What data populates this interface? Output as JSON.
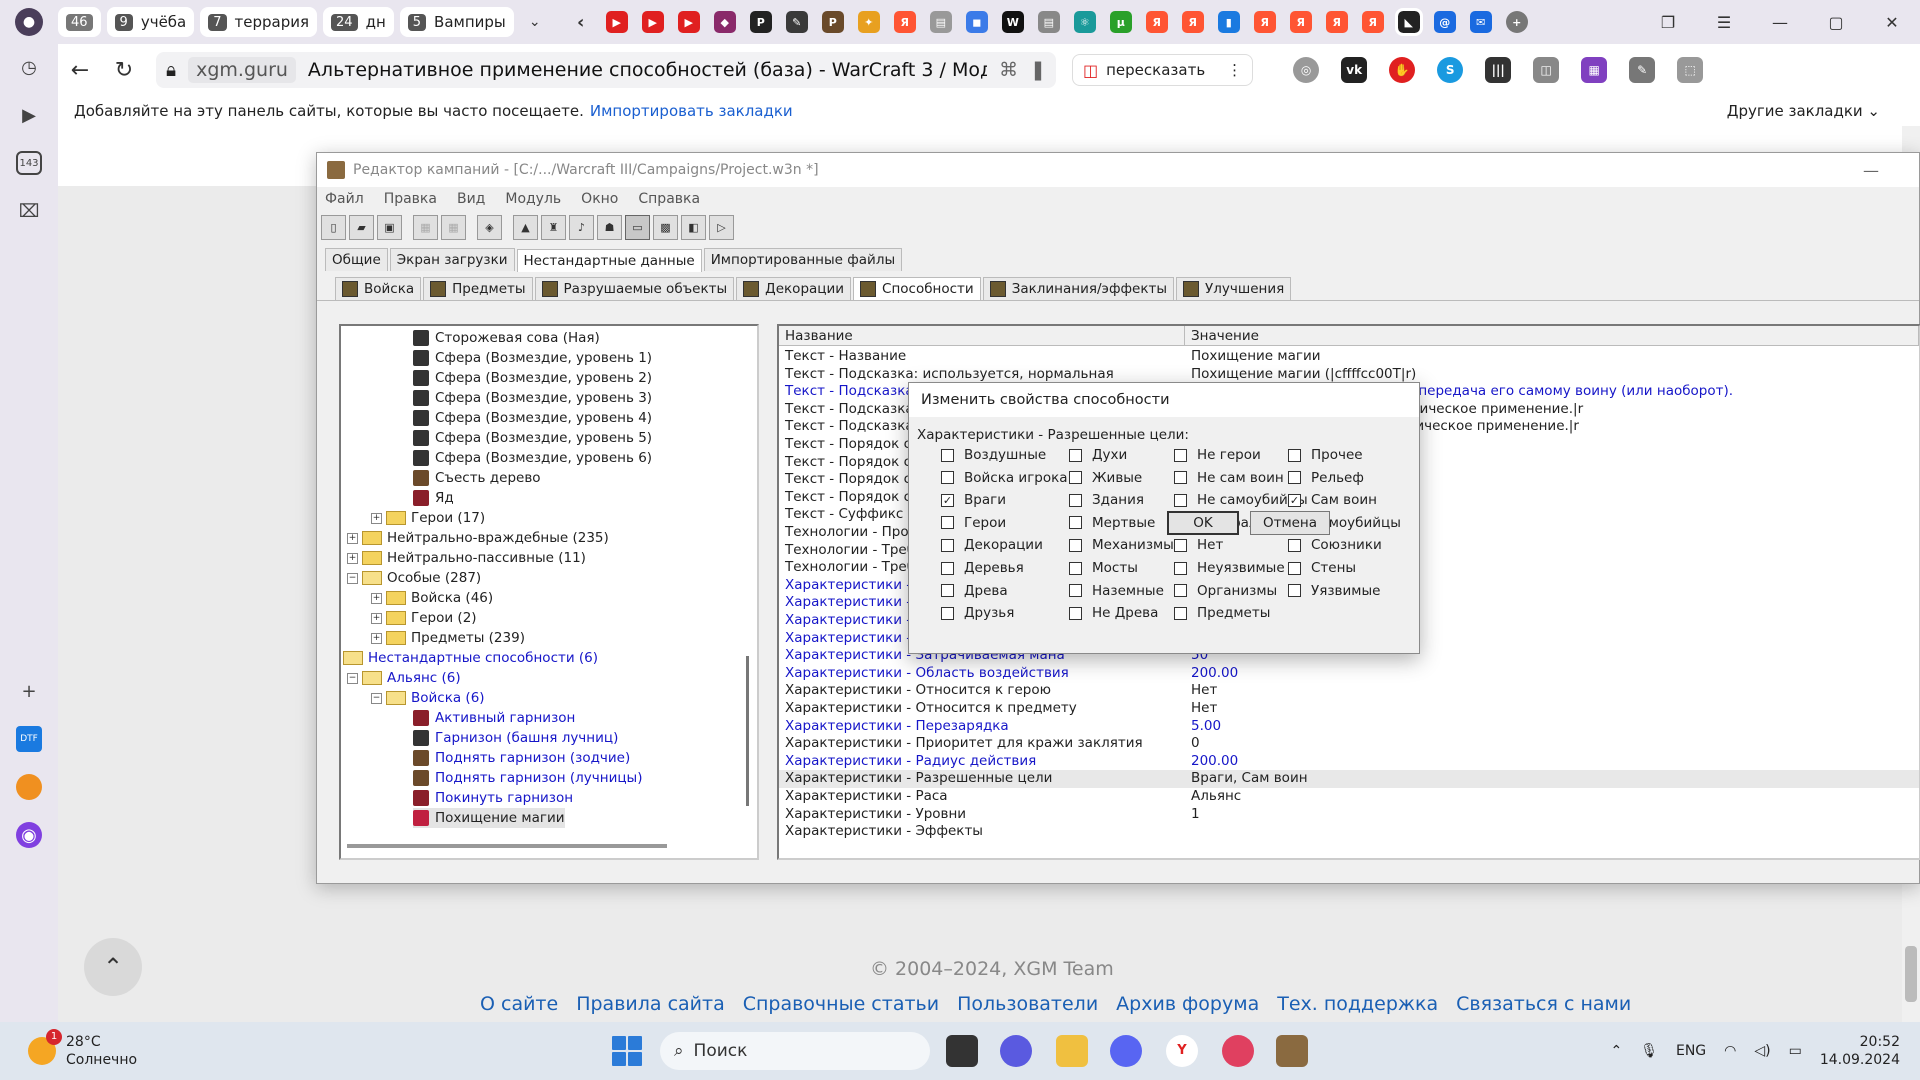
{
  "browser": {
    "tab_groups": [
      {
        "num": "46",
        "label": ""
      },
      {
        "num": "9",
        "label": "учёба"
      },
      {
        "num": "7",
        "label": "террария"
      },
      {
        "num": "24",
        "label": "дн"
      },
      {
        "num": "5",
        "label": "Вампиры"
      }
    ],
    "url_host": "xgm.guru",
    "page_title": "Альтернативное применение способностей (база) - WarCraft 3 / Моддинг - XG...",
    "retell_label": "пересказать",
    "bookmarks_hint": "Добавляйте на эту панель сайты, которые вы часто посещаете.",
    "bookmarks_import": "Импортировать закладки",
    "bookmarks_other": "Другие закладки",
    "sidebar_badge": "143"
  },
  "page": {
    "copyright": "© 2004–2024, XGM Team",
    "footer_links": [
      "О сайте",
      "Правила сайта",
      "Справочные статьи",
      "Пользователи",
      "Архив форума",
      "Тех. поддержка",
      "Связаться с нами"
    ]
  },
  "editor": {
    "title": "Редактор кампаний - [C:/.../Warcraft III/Campaigns/Project.w3n *]",
    "menu": [
      "Файл",
      "Правка",
      "Вид",
      "Модуль",
      "Окно",
      "Справка"
    ],
    "tabs_top": [
      "Общие",
      "Экран загрузки",
      "Нестандартные данные",
      "Импортированные файлы"
    ],
    "tabs_objects": [
      "Войска",
      "Предметы",
      "Разрушаемые объекты",
      "Декорации",
      "Способности",
      "Заклинания/эффекты",
      "Улучшения"
    ],
    "tree": [
      {
        "label": "Сторожевая сова (Ная)"
      },
      {
        "label": "Сфера (Возмездие, уровень 1)"
      },
      {
        "label": "Сфера (Возмездие, уровень 2)"
      },
      {
        "label": "Сфера (Возмездие, уровень 3)"
      },
      {
        "label": "Сфера (Возмездие, уровень 4)"
      },
      {
        "label": "Сфера (Возмездие, уровень 5)"
      },
      {
        "label": "Сфера (Возмездие, уровень 6)"
      },
      {
        "label": "Съесть дерево"
      },
      {
        "label": "Яд"
      },
      {
        "label": "Герои (17)"
      },
      {
        "label": "Нейтрально-враждебные (235)"
      },
      {
        "label": "Нейтрально-пассивные (11)"
      },
      {
        "label": "Особые (287)"
      },
      {
        "label": "Войска (46)"
      },
      {
        "label": "Герои (2)"
      },
      {
        "label": "Предметы (239)"
      },
      {
        "label": "Нестандартные способности (6)"
      },
      {
        "label": "Альянс (6)"
      },
      {
        "label": "Войска (6)"
      },
      {
        "label": "Активный гарнизон"
      },
      {
        "label": "Гарнизон (башня лучниц)"
      },
      {
        "label": "Поднять гарнизон (зодчие)"
      },
      {
        "label": "Поднять гарнизон (лучницы)"
      },
      {
        "label": "Покинуть гарнизон"
      },
      {
        "label": "Похищение магии"
      }
    ],
    "props_header": {
      "name": "Название",
      "value": "Значение"
    },
    "props": [
      {
        "n": "Текст - Название",
        "v": "Похищение магии"
      },
      {
        "n": "Текст - Подсказка: используется, нормальная",
        "v": "Похищение магии (|cffffcc00T|r)"
      },
      {
        "n": "Текст - Подсказка: используется, расширенная",
        "v": "наложенного на противника, и передача его самому воину (или наоборот)."
      },
      {
        "n": "Текст - Подсказка: включено автоприменение",
        "v": "ыши, чтобы разрешить автоматическое применение.|r"
      },
      {
        "n": "Текст - Подсказка: отключено автоприменение",
        "v": "ыши, чтобы запретить автоматическое применение.|r"
      },
      {
        "n": "Текст - Порядок строки - использовать/включить",
        "v": ""
      },
      {
        "n": "Текст - Порядок строки - отключить",
        "v": ""
      },
      {
        "n": "Текст - Порядок строки - включить автоприменение",
        "v": ""
      },
      {
        "n": "Текст - Порядок строки - отключить автоприменение",
        "v": ""
      },
      {
        "n": "Текст - Суффикс редактора",
        "v": ""
      },
      {
        "n": "Технологии - Проверять зависимости",
        "v": ""
      },
      {
        "n": "Технологии - Требования",
        "v": ""
      },
      {
        "n": "Технологии - Требования - уровни",
        "v": ""
      },
      {
        "n": "Характеристики - Время действия - герой",
        "v": ""
      },
      {
        "n": "Характеристики - Длительность - нормальная",
        "v": ""
      },
      {
        "n": "Характеристики - Дальность применения",
        "v": ""
      },
      {
        "n": "Характеристики - Затраты золота",
        "v": ""
      },
      {
        "n": "Характеристики - Затрачиваемая мана",
        "v": "50"
      },
      {
        "n": "Характеристики - Область воздействия",
        "v": "200.00"
      },
      {
        "n": "Характеристики - Относится к герою",
        "v": "Нет"
      },
      {
        "n": "Характеристики - Относится к предмету",
        "v": "Нет"
      },
      {
        "n": "Характеристики - Перезарядка",
        "v": "5.00"
      },
      {
        "n": "Характеристики - Приоритет для кражи заклятия",
        "v": "0"
      },
      {
        "n": "Характеристики - Радиус действия",
        "v": "200.00"
      },
      {
        "n": "Характеристики - Разрешенные цели",
        "v": "Враги, Сам воин"
      },
      {
        "n": "Характеристики - Раса",
        "v": "Альянс"
      },
      {
        "n": "Характеристики - Уровни",
        "v": "1"
      },
      {
        "n": "Характеристики - Эффекты",
        "v": ""
      }
    ]
  },
  "dialog": {
    "title": "Изменить свойства способности",
    "label": "Характеристики - Разрешенные цели:",
    "columns": [
      [
        {
          "label": "Воздушные",
          "checked": false
        },
        {
          "label": "Войска игрока",
          "checked": false
        },
        {
          "label": "Враги",
          "checked": true
        },
        {
          "label": "Герои",
          "checked": false
        },
        {
          "label": "Декорации",
          "checked": false
        },
        {
          "label": "Деревья",
          "checked": false
        },
        {
          "label": "Древа",
          "checked": false
        },
        {
          "label": "Друзья",
          "checked": false
        }
      ],
      [
        {
          "label": "Духи",
          "checked": false
        },
        {
          "label": "Живые",
          "checked": false
        },
        {
          "label": "Здания",
          "checked": false
        },
        {
          "label": "Мертвые",
          "checked": false
        },
        {
          "label": "Механизмы",
          "checked": false
        },
        {
          "label": "Мосты",
          "checked": false
        },
        {
          "label": "Наземные",
          "checked": false
        },
        {
          "label": "Не Древа",
          "checked": false
        }
      ],
      [
        {
          "label": "Не герои",
          "checked": false
        },
        {
          "label": "Не сам воин",
          "checked": false
        },
        {
          "label": "Не самоубийцы",
          "checked": false
        },
        {
          "label": "Нейтральные",
          "checked": false
        },
        {
          "label": "Нет",
          "checked": false
        },
        {
          "label": "Неуязвимые",
          "checked": false
        },
        {
          "label": "Организмы",
          "checked": false
        },
        {
          "label": "Предметы",
          "checked": false
        }
      ],
      [
        {
          "label": "Прочее",
          "checked": false
        },
        {
          "label": "Рельеф",
          "checked": false
        },
        {
          "label": "Сам воин",
          "checked": true
        },
        {
          "label": "Самоубийцы",
          "checked": false
        },
        {
          "label": "Союзники",
          "checked": false
        },
        {
          "label": "Стены",
          "checked": false
        },
        {
          "label": "Уязвимые",
          "checked": false
        }
      ]
    ],
    "ok_label": "OK",
    "cancel_label": "Отмена"
  },
  "taskbar": {
    "weather_temp": "28°C",
    "weather_desc": "Солнечно",
    "weather_badge": "1",
    "search_placeholder": "Поиск",
    "lang": "ENG",
    "time": "20:52",
    "date": "14.09.2024"
  }
}
